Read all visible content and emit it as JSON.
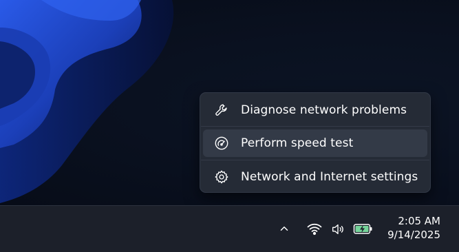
{
  "menu": {
    "items": [
      {
        "label": "Diagnose network problems",
        "icon": "wrench-icon"
      },
      {
        "label": "Perform speed test",
        "icon": "speedometer-icon"
      },
      {
        "label": "Network and Internet settings",
        "icon": "gear-icon"
      }
    ]
  },
  "taskbar": {
    "time": "2:05 AM",
    "date": "9/14/2025",
    "tray_icons": [
      "chevron-up-icon",
      "wifi-icon",
      "volume-icon",
      "battery-charging-icon"
    ]
  },
  "colors": {
    "battery_accent": "#76d49a",
    "wallpaper_blue": "#1f48c7"
  }
}
